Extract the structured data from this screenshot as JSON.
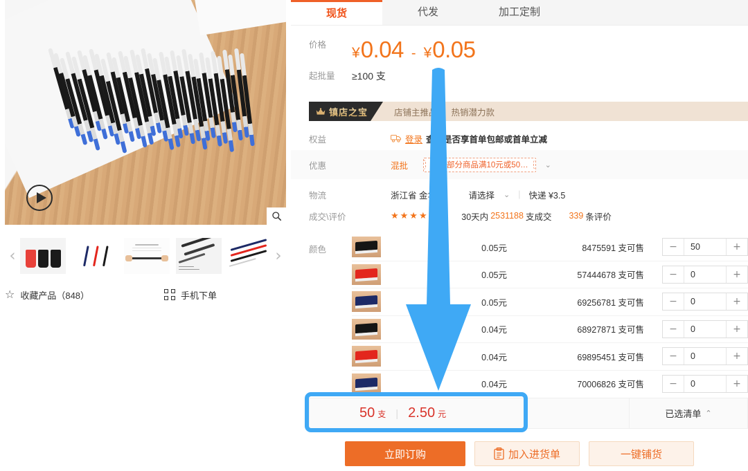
{
  "gallery": {
    "play_icon": "play-circle-icon",
    "zoom_icon": "magnifier-icon",
    "prev_icon": "chevron-left-icon",
    "next_icon": "chevron-right-icon",
    "thumbnails": [
      {
        "name": "thumb-pen-packs"
      },
      {
        "name": "thumb-three-pens"
      },
      {
        "name": "thumb-spec-sheet"
      },
      {
        "name": "thumb-pens-closeup"
      },
      {
        "name": "thumb-pens-fan"
      }
    ],
    "favorite": {
      "icon": "star-outline-icon",
      "label": "收藏产品（848）",
      "count": "848"
    },
    "mobile_order": {
      "icon": "qr-code-icon",
      "label": "手机下单"
    }
  },
  "tabs": [
    {
      "label": "现货",
      "active": true
    },
    {
      "label": "代发",
      "active": false
    },
    {
      "label": "加工定制",
      "active": false
    }
  ],
  "price": {
    "label": "价格",
    "currency": "¥",
    "min": "0.04",
    "max": "0.05",
    "dash": "-"
  },
  "moq": {
    "label": "起批量",
    "value": "≥100 支"
  },
  "badge": {
    "crown_icon": "crown-icon",
    "title": "镇店之宝",
    "tags": [
      "店铺主推品",
      "热销潜力款"
    ]
  },
  "benefits": {
    "label": "权益",
    "truck_icon": "truck-icon",
    "login_link": "登录",
    "text": "查看是否享首单包邮或首单立减"
  },
  "promo": {
    "label": "优惠",
    "mix_label": "混批",
    "coupon_text": "本店部分商品满10元或50…",
    "chevron_icon": "chevron-down-icon"
  },
  "logistics": {
    "label": "物流",
    "origin": "浙江省 金华市",
    "select_placeholder": "请选择",
    "chevron_icon": "chevron-down-icon",
    "shipping": "快递 ¥3.5"
  },
  "reviews": {
    "label": "成交\\评价",
    "stars": "★★★★★",
    "rating": 4.5,
    "period": "30天内",
    "sales_count": "2531188",
    "sales_suffix": "支成交",
    "review_count": "339",
    "review_suffix": "条评价"
  },
  "sku": {
    "label": "颜色",
    "minus_icon": "minus-icon",
    "plus_icon": "plus-icon",
    "rows": [
      {
        "color": "#151515",
        "price": "0.05元",
        "stock": "8475591 支可售",
        "qty": "50"
      },
      {
        "color": "#e3261d",
        "price": "0.05元",
        "stock": "57444678 支可售",
        "qty": "0"
      },
      {
        "color": "#1d2a66",
        "price": "0.05元",
        "stock": "69256781 支可售",
        "qty": "0"
      },
      {
        "color": "#151515",
        "price": "0.04元",
        "stock": "68927871 支可售",
        "qty": "0"
      },
      {
        "color": "#e3261d",
        "price": "0.04元",
        "stock": "69895451 支可售",
        "qty": "0"
      },
      {
        "color": "#1d2a66",
        "price": "0.04元",
        "stock": "70006826 支可售",
        "qty": "0"
      }
    ]
  },
  "summary": {
    "qty": "50",
    "qty_unit": "支",
    "divider": "|",
    "amount": "2.50",
    "amount_unit": "元",
    "selected_list_label": "已选清单",
    "chevron_icon": "chevron-up-icon"
  },
  "actions": [
    {
      "name": "order-now-button",
      "label": "立即订购",
      "style": "primary"
    },
    {
      "name": "add-to-purchase-list-button",
      "label": "加入进货单",
      "style": "ghost",
      "icon": "clipboard-icon"
    },
    {
      "name": "one-click-distribute-button",
      "label": "一键铺货",
      "style": "ghost"
    }
  ],
  "annotations": {
    "arrow_color": "#3fa9f5",
    "highlight_color": "#3fa9f5",
    "arrow_name": "blue-down-arrow-annotation",
    "highlight_name": "blue-highlight-box-annotation"
  },
  "colors": {
    "accent_orange": "#ed6d27",
    "price_orange": "#f2741b",
    "red": "#d9342b",
    "annotation_blue": "#3fa9f5"
  }
}
